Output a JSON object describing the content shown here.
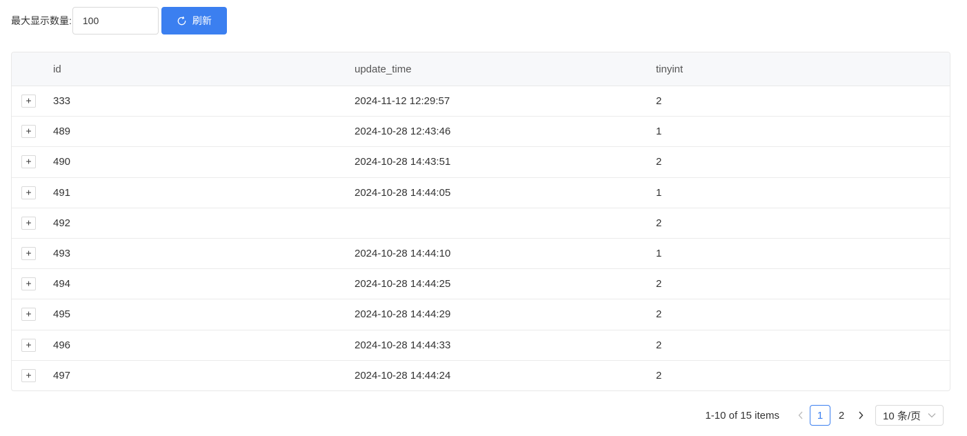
{
  "toolbar": {
    "label": "最大显示数量:",
    "count_value": "100",
    "refresh_label": "刷新"
  },
  "table": {
    "columns": [
      "id",
      "update_time",
      "tinyint"
    ],
    "rows": [
      {
        "id": "333",
        "update_time": "2024-11-12 12:29:57",
        "tinyint": "2"
      },
      {
        "id": "489",
        "update_time": "2024-10-28 12:43:46",
        "tinyint": "1"
      },
      {
        "id": "490",
        "update_time": "2024-10-28 14:43:51",
        "tinyint": "2"
      },
      {
        "id": "491",
        "update_time": "2024-10-28 14:44:05",
        "tinyint": "1"
      },
      {
        "id": "492",
        "update_time": "",
        "tinyint": "2"
      },
      {
        "id": "493",
        "update_time": "2024-10-28 14:44:10",
        "tinyint": "1"
      },
      {
        "id": "494",
        "update_time": "2024-10-28 14:44:25",
        "tinyint": "2"
      },
      {
        "id": "495",
        "update_time": "2024-10-28 14:44:29",
        "tinyint": "2"
      },
      {
        "id": "496",
        "update_time": "2024-10-28 14:44:33",
        "tinyint": "2"
      },
      {
        "id": "497",
        "update_time": "2024-10-28 14:44:24",
        "tinyint": "2"
      }
    ],
    "expand_symbol": "+"
  },
  "pagination": {
    "total_text": "1-10 of 15 items",
    "pages": [
      "1",
      "2"
    ],
    "current_page": "1",
    "page_size": "10 条/页"
  },
  "colors": {
    "primary": "#3b7ff0",
    "header_bg": "#f7f8fa",
    "border": "#e8e8e8"
  }
}
